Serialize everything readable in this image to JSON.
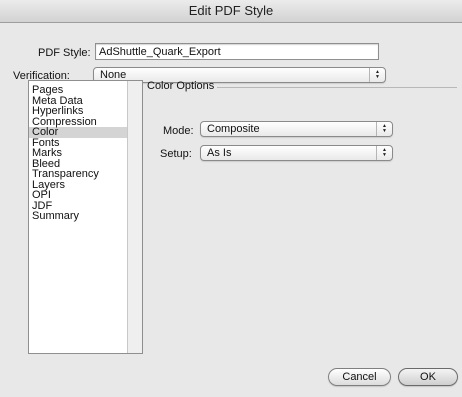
{
  "window": {
    "title": "Edit PDF Style"
  },
  "form": {
    "pdf_style_label": "PDF Style:",
    "pdf_style_value": "AdShuttle_Quark_Export",
    "verification_label": "Verification:",
    "verification_value": "None"
  },
  "categories": {
    "items": [
      "Pages",
      "Meta Data",
      "Hyperlinks",
      "Compression",
      "Color",
      "Fonts",
      "Marks",
      "Bleed",
      "Transparency",
      "Layers",
      "OPI",
      "JDF",
      "Summary"
    ],
    "selected": "Color"
  },
  "color_options": {
    "title": "Color Options",
    "mode_label": "Mode:",
    "mode_value": "Composite",
    "setup_label": "Setup:",
    "setup_value": "As Is"
  },
  "buttons": {
    "cancel": "Cancel",
    "ok": "OK"
  }
}
